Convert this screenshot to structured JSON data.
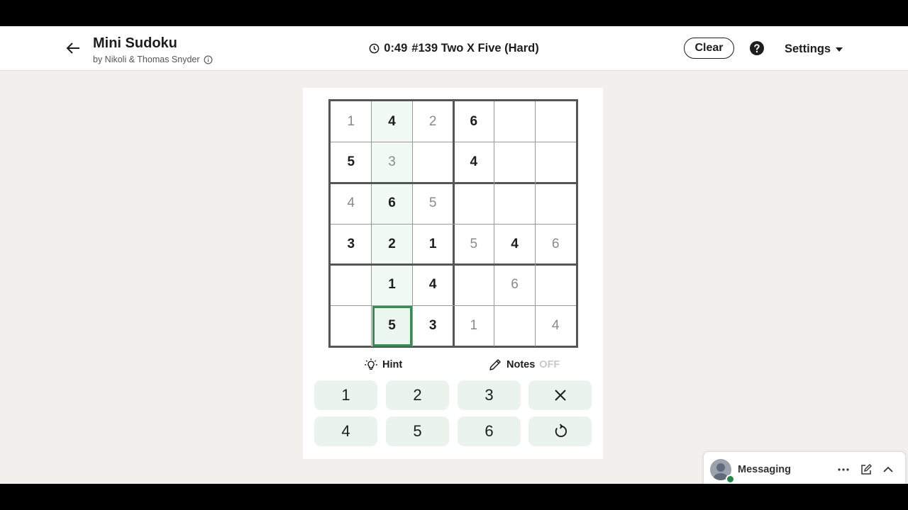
{
  "header": {
    "title": "Mini Sudoku",
    "byline": "by Nikoli & Thomas Snyder",
    "timer": "0:49",
    "puzzle_name": "#139 Two X Five (Hard)",
    "clear_label": "Clear",
    "settings_label": "Settings"
  },
  "grid": {
    "rows": [
      [
        {
          "v": "1",
          "t": "entered"
        },
        {
          "v": "4",
          "t": "given"
        },
        {
          "v": "2",
          "t": "entered"
        },
        {
          "v": "6",
          "t": "given"
        },
        {
          "v": "",
          "t": "empty"
        },
        {
          "v": "",
          "t": "empty"
        }
      ],
      [
        {
          "v": "5",
          "t": "given"
        },
        {
          "v": "3",
          "t": "entered"
        },
        {
          "v": "",
          "t": "empty"
        },
        {
          "v": "4",
          "t": "given"
        },
        {
          "v": "",
          "t": "empty"
        },
        {
          "v": "",
          "t": "empty"
        }
      ],
      [
        {
          "v": "4",
          "t": "entered"
        },
        {
          "v": "6",
          "t": "given"
        },
        {
          "v": "5",
          "t": "entered"
        },
        {
          "v": "",
          "t": "empty"
        },
        {
          "v": "",
          "t": "empty"
        },
        {
          "v": "",
          "t": "empty"
        }
      ],
      [
        {
          "v": "3",
          "t": "given"
        },
        {
          "v": "2",
          "t": "given"
        },
        {
          "v": "1",
          "t": "given"
        },
        {
          "v": "5",
          "t": "entered"
        },
        {
          "v": "4",
          "t": "given"
        },
        {
          "v": "6",
          "t": "entered"
        }
      ],
      [
        {
          "v": "",
          "t": "empty"
        },
        {
          "v": "1",
          "t": "given"
        },
        {
          "v": "4",
          "t": "given"
        },
        {
          "v": "",
          "t": "empty"
        },
        {
          "v": "6",
          "t": "entered"
        },
        {
          "v": "",
          "t": "empty"
        }
      ],
      [
        {
          "v": "",
          "t": "empty"
        },
        {
          "v": "5",
          "t": "given"
        },
        {
          "v": "3",
          "t": "given"
        },
        {
          "v": "1",
          "t": "entered"
        },
        {
          "v": "",
          "t": "empty"
        },
        {
          "v": "4",
          "t": "entered"
        }
      ]
    ],
    "selected": {
      "row": 5,
      "col": 1
    }
  },
  "controls": {
    "hint_label": "Hint",
    "notes_label": "Notes",
    "notes_state": "OFF"
  },
  "keypad": {
    "keys": [
      "1",
      "2",
      "3",
      "4",
      "5",
      "6"
    ],
    "erase_icon": "close-icon",
    "undo_icon": "undo-icon"
  },
  "messaging": {
    "label": "Messaging"
  },
  "colors": {
    "selected_border": "#3b8a55",
    "key_bg": "#eaf3ee",
    "given_digit": "#1d1d1d",
    "entered_digit": "#8a8a8a"
  }
}
